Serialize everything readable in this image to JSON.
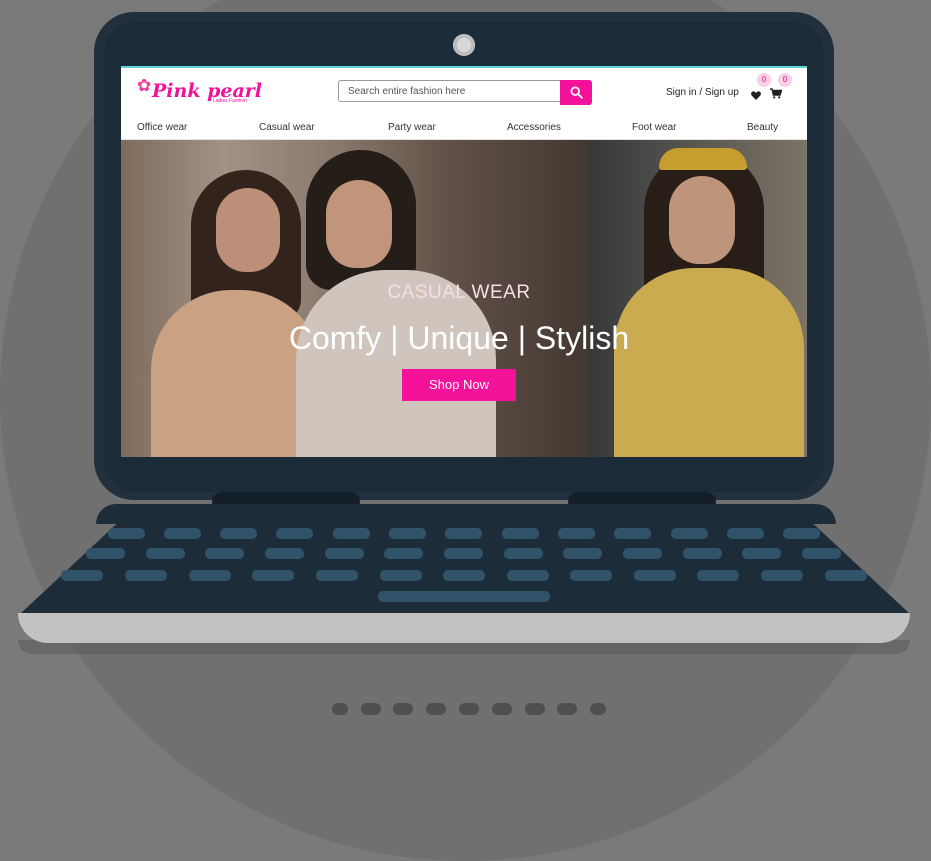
{
  "brand": {
    "name": "Pink pearl",
    "tagline": "Ladies Fashion",
    "accent_color": "#f5129b"
  },
  "search": {
    "placeholder": "Search entire fashion here",
    "button_icon": "search-icon"
  },
  "account": {
    "signin_label": "Sign in / Sign up",
    "wishlist_icon": "heart-icon",
    "wishlist_count": "0",
    "cart_icon": "cart-icon",
    "cart_count": "0"
  },
  "nav": {
    "items": [
      {
        "label": "Office wear"
      },
      {
        "label": "Casual wear"
      },
      {
        "label": "Party wear"
      },
      {
        "label": "Accessories"
      },
      {
        "label": "Foot wear"
      },
      {
        "label": "Beauty"
      }
    ]
  },
  "hero": {
    "kicker": "CASUAL WEAR",
    "title": "Comfy | Unique | Stylish",
    "cta_label": "Shop Now"
  },
  "carousel": {
    "slide_count": 9
  }
}
